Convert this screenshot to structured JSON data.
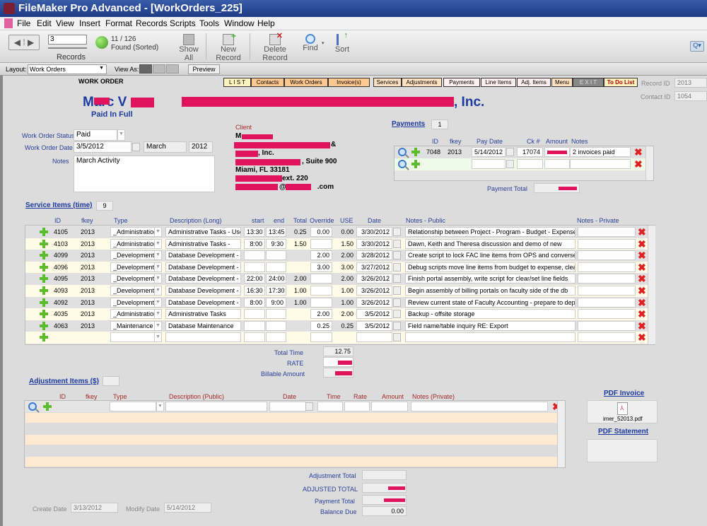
{
  "window": {
    "title": "FileMaker Pro Advanced - [WorkOrders_225]"
  },
  "menu": [
    "File",
    "Edit",
    "View",
    "Insert",
    "Format",
    "Records",
    "Scripts",
    "Tools",
    "Window",
    "Help"
  ],
  "toolbar": {
    "record_number": "3",
    "records_label": "Records",
    "found_count": "11 / 126",
    "found_status": "Found (Sorted)",
    "show_all": "Show All",
    "new_record": "New Record",
    "delete_record": "Delete Record",
    "find": "Find",
    "sort": "Sort"
  },
  "layoutbar": {
    "layout_label": "Layout:",
    "layout_value": "Work Orders",
    "view_as_label": "View As:",
    "preview": "Preview"
  },
  "nav_tabs": [
    {
      "label": "L I S T",
      "color": "#fff4c0"
    },
    {
      "label": "Contacts",
      "color": "#ffc890"
    },
    {
      "label": "Work Orders",
      "color": "#ffc890"
    },
    {
      "label": "Invoice(s)",
      "color": "#ffc890"
    },
    {
      "label": "Services",
      "color": "#ffe0c0"
    },
    {
      "label": "Adjustments",
      "color": "#ffe0c0"
    },
    {
      "label": "Payments",
      "color": "#fff0f0"
    },
    {
      "label": "Line Items",
      "color": "#fff0f0"
    },
    {
      "label": "Adj. Items",
      "color": "#fff0f0"
    },
    {
      "label": "Menu",
      "color": "#ffe0c0"
    },
    {
      "label": "E X I T",
      "color": "#888888"
    },
    {
      "label": "To Do List",
      "color": "#fff4c0"
    }
  ],
  "header": {
    "section_title": "WORK ORDER",
    "contact_name": "Marc V",
    "status_line": "Paid In Full",
    "org_suffix": ", Inc.",
    "record_id_label": "Record ID",
    "record_id": "2013",
    "contact_id_label": "Contact ID",
    "contact_id": "1054"
  },
  "work_order": {
    "status_label": "Work Order Status",
    "status": "Paid",
    "date_label": "Work Order Date",
    "date": "3/5/2012",
    "month": "March",
    "year": "2012",
    "notes_label": "Notes",
    "notes": "March Activity"
  },
  "client": {
    "label": "Client",
    "line1": "M",
    "line2_suffix": "&",
    "line3": ", Inc.",
    "line4": ", Suite 900",
    "line5": "Miami, FL  33181",
    "line6": "ext. 220",
    "line7_at": "@",
    "line7_end": ".com"
  },
  "payments": {
    "title": "Payments",
    "count": "1",
    "headers": [
      "ID",
      "fkey",
      "Pay Date",
      "Ck #",
      "Amount",
      "Notes"
    ],
    "rows": [
      {
        "id": "7048",
        "fkey": "2013",
        "pay_date": "5/14/2012",
        "ck": "17074",
        "amount": "",
        "notes": "2 invoices paid"
      }
    ],
    "total_label": "Payment Total"
  },
  "services": {
    "title": "Service Items (time)",
    "count": "9",
    "headers": [
      "ID",
      "fkey",
      "Type",
      "Description (Long)",
      "start",
      "end",
      "Total",
      "Override",
      "USE",
      "Date",
      "Notes - Public",
      "Notes - Private"
    ],
    "rows": [
      {
        "id": "4105",
        "fkey": "2013",
        "type": "_Administration",
        "desc": "Administrative Tasks - User",
        "start": "13:30",
        "end": "13:45",
        "total": "0.25",
        "override": "0.00",
        "use": "0.00",
        "date": "3/30/2012",
        "notes": "Relationship between Project - Program - Budget - Expenses"
      },
      {
        "id": "4103",
        "fkey": "2013",
        "type": "_Administration",
        "desc": "Administrative Tasks -",
        "start": "8:00",
        "end": "9:30",
        "total": "1.50",
        "override": "",
        "use": "1.50",
        "date": "3/30/2012",
        "notes": "Dawn, Keith and Theresa discussion and demo of new"
      },
      {
        "id": "4099",
        "fkey": "2013",
        "type": "_Development",
        "desc": "Database Development -",
        "start": "",
        "end": "",
        "total": "",
        "override": "2.00",
        "use": "2.00",
        "date": "3/28/2012",
        "notes": "Create script to lock FAC line items from OPS and conversely"
      },
      {
        "id": "4096",
        "fkey": "2013",
        "type": "_Development",
        "desc": "Database Development -",
        "start": "",
        "end": "",
        "total": "",
        "override": "3.00",
        "use": "3.00",
        "date": "3/27/2012",
        "notes": "Debug scripts move line items from budget to expense, clear/set,"
      },
      {
        "id": "4095",
        "fkey": "2013",
        "type": "_Development",
        "desc": "Database Development -",
        "start": "22:00",
        "end": "24:00",
        "total": "2.00",
        "override": "",
        "use": "2.00",
        "date": "3/26/2012",
        "notes": "Finish portal assembly, write script for clear/set line fields"
      },
      {
        "id": "4093",
        "fkey": "2013",
        "type": "_Development",
        "desc": "Database Development -",
        "start": "16:30",
        "end": "17:30",
        "total": "1.00",
        "override": "",
        "use": "1.00",
        "date": "3/26/2012",
        "notes": "Begin assembly of billing portals on faculty side of the db"
      },
      {
        "id": "4092",
        "fkey": "2013",
        "type": "_Development",
        "desc": "Database Development -",
        "start": "8:00",
        "end": "9:00",
        "total": "1.00",
        "override": "",
        "use": "1.00",
        "date": "3/26/2012",
        "notes": "Review current state of Faculty Accounting - prepare to deploy"
      },
      {
        "id": "4035",
        "fkey": "2013",
        "type": "_Administration",
        "desc": "Administrative Tasks",
        "start": "",
        "end": "",
        "total": "",
        "override": "2.00",
        "use": "2.00",
        "date": "3/5/2012",
        "notes": "Backup - offsite storage"
      },
      {
        "id": "4063",
        "fkey": "2013",
        "type": "_Maintenance",
        "desc": "Database Maintenance",
        "start": "",
        "end": "",
        "total": "",
        "override": "0.25",
        "use": "0.25",
        "date": "3/5/2012",
        "notes": "Field name/table inquiry RE: Export"
      },
      {
        "id": "",
        "fkey": "",
        "type": "",
        "desc": "",
        "start": "",
        "end": "",
        "total": "",
        "override": "",
        "use": "",
        "date": "",
        "notes": ""
      }
    ],
    "total_time_label": "Total Time",
    "total_time": "12.75",
    "rate_label": "RATE",
    "billable_label": "Billable Amount"
  },
  "adjustments": {
    "title": "Adjustment Items ($)",
    "headers": [
      "ID",
      "fkey",
      "Type",
      "Description (Public)",
      "Date",
      "Time",
      "Rate",
      "Amount",
      "Notes (Private)"
    ]
  },
  "pdf": {
    "invoice_label": "PDF Invoice",
    "invoice_file": "imer_52013.pdf",
    "statement_label": "PDF Statement"
  },
  "totals": {
    "adjustment_total": "Adjustment Total",
    "adjusted_total": "ADJUSTED TOTAL",
    "payment_total": "Payment Total",
    "balance_due_label": "Balance Due",
    "balance_due": "0.00"
  },
  "footer": {
    "create_label": "Create Date",
    "create_date": "3/13/2012",
    "modify_label": "Modify Date",
    "modify_date": "5/14/2012"
  }
}
